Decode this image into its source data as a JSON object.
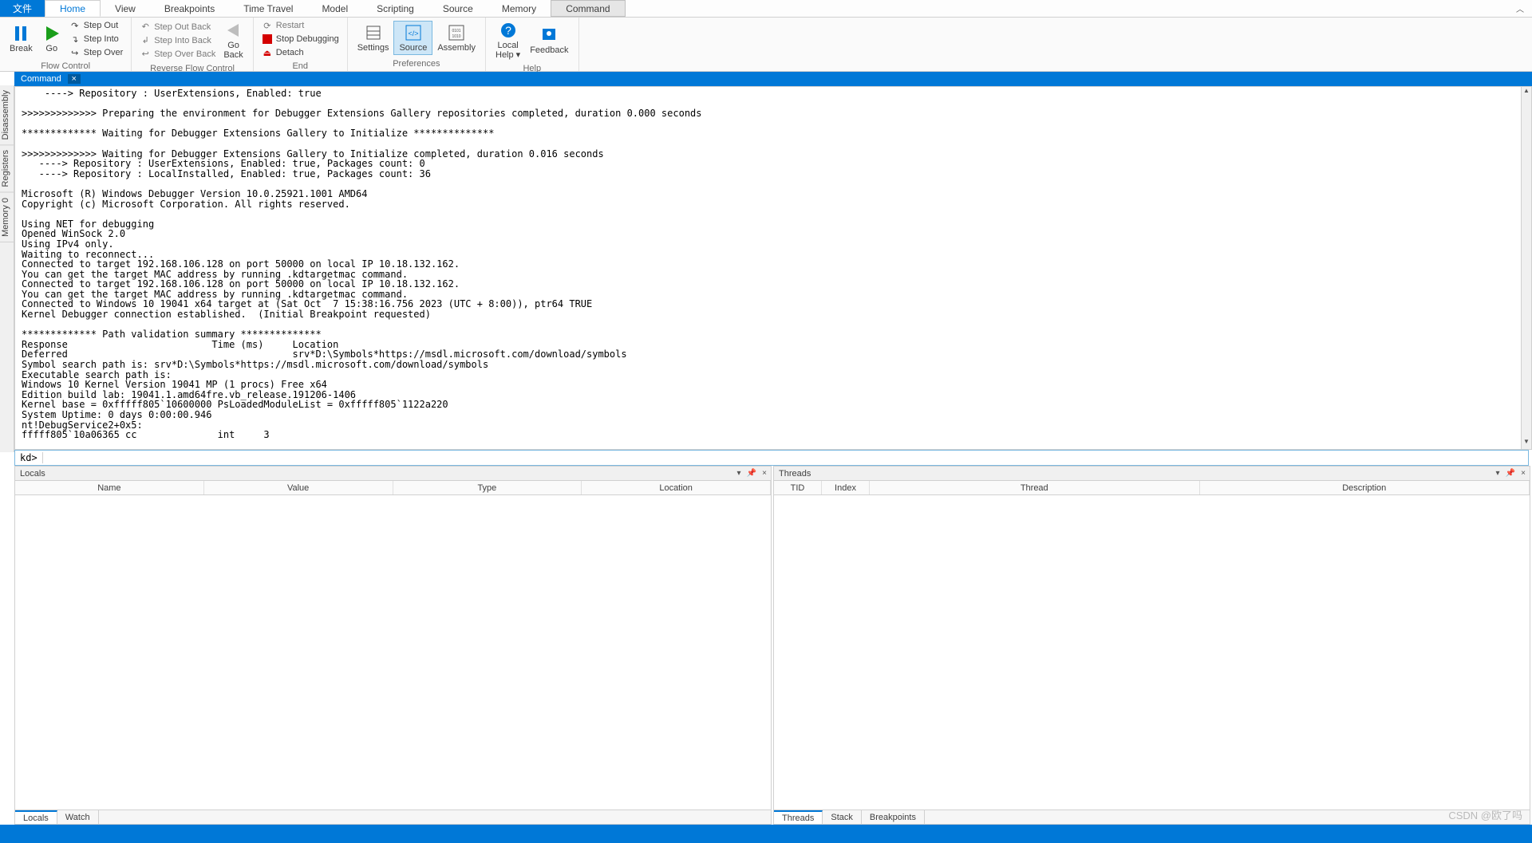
{
  "menu": {
    "file": "文件",
    "tabs": [
      "Home",
      "View",
      "Breakpoints",
      "Time Travel",
      "Model",
      "Scripting",
      "Source",
      "Memory",
      "Command"
    ],
    "active": "Home",
    "highlighted": "Command"
  },
  "ribbon": {
    "flow": {
      "label": "Flow Control",
      "break": "Break",
      "go": "Go",
      "step_out": "Step Out",
      "step_into": "Step Into",
      "step_over": "Step Over"
    },
    "rflow": {
      "label": "Reverse Flow Control",
      "step_out_back": "Step Out Back",
      "step_into_back": "Step Into Back",
      "step_over_back": "Step Over Back",
      "go_back": "Go\nBack"
    },
    "end": {
      "label": "End",
      "restart": "Restart",
      "stop": "Stop Debugging",
      "detach": "Detach"
    },
    "prefs": {
      "label": "Preferences",
      "settings": "Settings",
      "source": "Source",
      "assembly": "Assembly"
    },
    "help": {
      "label": "Help",
      "local_help": "Local\nHelp ▾",
      "feedback": "Feedback"
    }
  },
  "side_tabs": [
    "Disassembly",
    "Registers",
    "Memory 0"
  ],
  "command_window": {
    "title": "Command",
    "prompt": "kd>",
    "output": "    ----> Repository : UserExtensions, Enabled: true\n\n>>>>>>>>>>>>> Preparing the environment for Debugger Extensions Gallery repositories completed, duration 0.000 seconds\n\n************* Waiting for Debugger Extensions Gallery to Initialize **************\n\n>>>>>>>>>>>>> Waiting for Debugger Extensions Gallery to Initialize completed, duration 0.016 seconds\n   ----> Repository : UserExtensions, Enabled: true, Packages count: 0\n   ----> Repository : LocalInstalled, Enabled: true, Packages count: 36\n\nMicrosoft (R) Windows Debugger Version 10.0.25921.1001 AMD64\nCopyright (c) Microsoft Corporation. All rights reserved.\n\nUsing NET for debugging\nOpened WinSock 2.0\nUsing IPv4 only.\nWaiting to reconnect...\nConnected to target 192.168.106.128 on port 50000 on local IP 10.18.132.162.\nYou can get the target MAC address by running .kdtargetmac command.\nConnected to target 192.168.106.128 on port 50000 on local IP 10.18.132.162.\nYou can get the target MAC address by running .kdtargetmac command.\nConnected to Windows 10 19041 x64 target at (Sat Oct  7 15:38:16.756 2023 (UTC + 8:00)), ptr64 TRUE\nKernel Debugger connection established.  (Initial Breakpoint requested)\n\n************* Path validation summary **************\nResponse                         Time (ms)     Location\nDeferred                                       srv*D:\\Symbols*https://msdl.microsoft.com/download/symbols\nSymbol search path is: srv*D:\\Symbols*https://msdl.microsoft.com/download/symbols\nExecutable search path is: \nWindows 10 Kernel Version 19041 MP (1 procs) Free x64\nEdition build lab: 19041.1.amd64fre.vb_release.191206-1406\nKernel base = 0xfffff805`10600000 PsLoadedModuleList = 0xfffff805`1122a220\nSystem Uptime: 0 days 0:00:00.946\nnt!DebugService2+0x5:\nfffff805`10a06365 cc              int     3"
  },
  "locals": {
    "title": "Locals",
    "cols": [
      "Name",
      "Value",
      "Type",
      "Location"
    ],
    "tabs": [
      "Locals",
      "Watch"
    ],
    "active_tab": "Locals"
  },
  "threads": {
    "title": "Threads",
    "cols": [
      "TID",
      "Index",
      "Thread",
      "Description"
    ],
    "tabs": [
      "Threads",
      "Stack",
      "Breakpoints"
    ],
    "active_tab": "Threads"
  },
  "watermark": "CSDN @欧了吗"
}
